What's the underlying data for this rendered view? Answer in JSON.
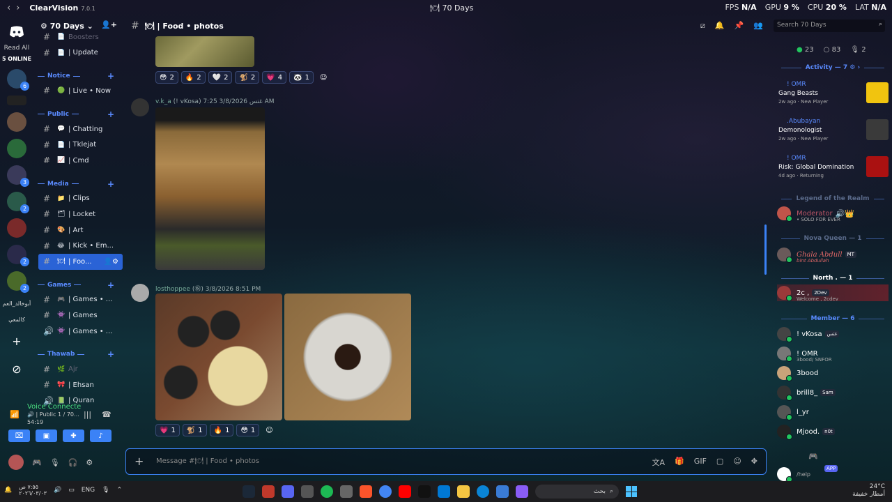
{
  "titlebar": {
    "app": "ClearVision",
    "version": "7.0.1",
    "window_title": "70 Days",
    "fps_label": "FPS",
    "fps": "N/A",
    "gpu_label": "GPU",
    "gpu": "9 %",
    "cpu_label": "CPU",
    "cpu": "20 %",
    "lat_label": "LAT",
    "lat": "N/A"
  },
  "server_rail": {
    "read_all": "Read All",
    "online": "5 ONLINE",
    "badges": [
      "6",
      "3",
      "2",
      "2",
      "2"
    ],
    "arabic_1": "أبوخالد_العم",
    "arabic_2": "كالمعي"
  },
  "guild": {
    "name": "70 Days"
  },
  "channels": [
    {
      "type": "ch",
      "icon": "📄",
      "name": "Boosters",
      "dim": true
    },
    {
      "type": "ch",
      "icon": "📄",
      "name": "| Update"
    },
    {
      "type": "cat",
      "name": "Notice"
    },
    {
      "type": "ch",
      "icon": "🟢",
      "name": "| Live • Now"
    },
    {
      "type": "cat",
      "name": "Public"
    },
    {
      "type": "ch",
      "icon": "💬",
      "name": "| Chatting"
    },
    {
      "type": "ch",
      "icon": "📄",
      "name": "| Tklejat"
    },
    {
      "type": "ch",
      "icon": "📈",
      "name": "| Cmd"
    },
    {
      "type": "cat",
      "name": "Media"
    },
    {
      "type": "ch",
      "icon": "📁",
      "name": "| Clips"
    },
    {
      "type": "ch",
      "icon": "🗂",
      "name": "| Locket"
    },
    {
      "type": "ch",
      "icon": "🎨",
      "name": "| Art"
    },
    {
      "type": "ch",
      "icon": "😂",
      "name": "| Kick • Em..."
    },
    {
      "type": "ch",
      "icon": "🍽",
      "name": "| Foo...",
      "active": true
    },
    {
      "type": "cat",
      "name": "Games"
    },
    {
      "type": "ch",
      "icon": "🎮",
      "name": "| Games • ..."
    },
    {
      "type": "ch",
      "icon": "👾",
      "name": "| Games"
    },
    {
      "type": "ch",
      "icon": "👾",
      "name": "| Games • ...",
      "speaker": true
    },
    {
      "type": "cat",
      "name": "Thawab"
    },
    {
      "type": "ch",
      "icon": "🌿",
      "name": "Ajr",
      "dim": true
    },
    {
      "type": "ch",
      "icon": "🎀",
      "name": "| Ehsan"
    },
    {
      "type": "ch",
      "icon": "📗",
      "name": "| Quran",
      "speaker": true
    }
  ],
  "voice": {
    "status": "Voice Connecte",
    "channel": "| Public 1 / 70...",
    "time": "54:19"
  },
  "header": {
    "channel": "| Food • photos"
  },
  "search": {
    "placeholder": "Search 70 Days"
  },
  "messages": {
    "reactions_top": [
      {
        "e": "😳",
        "n": "2"
      },
      {
        "e": "🔥",
        "n": "2"
      },
      {
        "e": "🤍",
        "n": "2"
      },
      {
        "e": "🐒",
        "n": "2"
      },
      {
        "e": "💗",
        "n": "4"
      },
      {
        "e": "🐼",
        "n": "1"
      }
    ],
    "msg1": {
      "author": "v.k_a",
      "tag": "(! vKosa)",
      "badge": "غتس",
      "time": "3/8/2026 7:25 AM"
    },
    "msg2": {
      "author": "losthoppee",
      "tag": "(㊗)",
      "time": "3/8/2026 8:51 PM"
    },
    "reactions_bottom": [
      {
        "e": "💗",
        "n": "1"
      },
      {
        "e": "🐒",
        "n": "1"
      },
      {
        "e": "🔥",
        "n": "1"
      },
      {
        "e": "😳",
        "n": "1"
      }
    ]
  },
  "composer": {
    "placeholder": "Message #🍽 | Food • photos"
  },
  "members": {
    "stats": {
      "online": "23",
      "idle": "83",
      "voice": "2"
    },
    "activity_title": "Activity — 7",
    "activities": [
      {
        "who": "! OMR",
        "game": "Gang Beasts",
        "ago": "2w ago",
        "status": "New Player",
        "color": "#f1c40f"
      },
      {
        "who": ".Abubayan",
        "game": "Demonologist",
        "ago": "2w ago",
        "status": "New Player",
        "color": "#3a3a3a"
      },
      {
        "who": "! OMR",
        "game": "Risk: Global Domination",
        "ago": "4d ago",
        "status": "Returning",
        "color": "#a11"
      }
    ],
    "legend_title": "Legend of the Realm",
    "legend_member": {
      "name": "Moderator",
      "sub": "• SOLO FOR EVER"
    },
    "nova_title": "Nova Queen — 1",
    "nova_member": {
      "name": "Ghala Abdull",
      "sub": "bint Abdullah",
      "tag": "MT"
    },
    "north_title": "North . — 1",
    "north_member": {
      "name": "2c ,",
      "tag": "2Dev",
      "sub": "Welcome , 2cdev"
    },
    "member_title": "Member — 6",
    "member_list": [
      {
        "name": "! vKosa",
        "tag": "غتس",
        "sub": ""
      },
      {
        "name": "! OMR",
        "tag": "",
        "sub": "3bood/ SNFOR"
      },
      {
        "name": "3bood",
        "tag": "",
        "sub": ""
      },
      {
        "name": "brill8_",
        "tag": "Sam",
        "sub": ""
      },
      {
        "name": "l_yr",
        "tag": "",
        "sub": ""
      },
      {
        "name": "Mjood.",
        "tag": "n0t",
        "sub": ""
      }
    ],
    "help": "/help",
    "app_tag": "APP"
  },
  "taskbar": {
    "time": "٧:٥٥ ص",
    "date": "٢٠٢٦/٠٣/٠٣",
    "lang": "ENG",
    "search": "بحث",
    "temp": "24°C",
    "weather": "أمطار خفيفة"
  }
}
